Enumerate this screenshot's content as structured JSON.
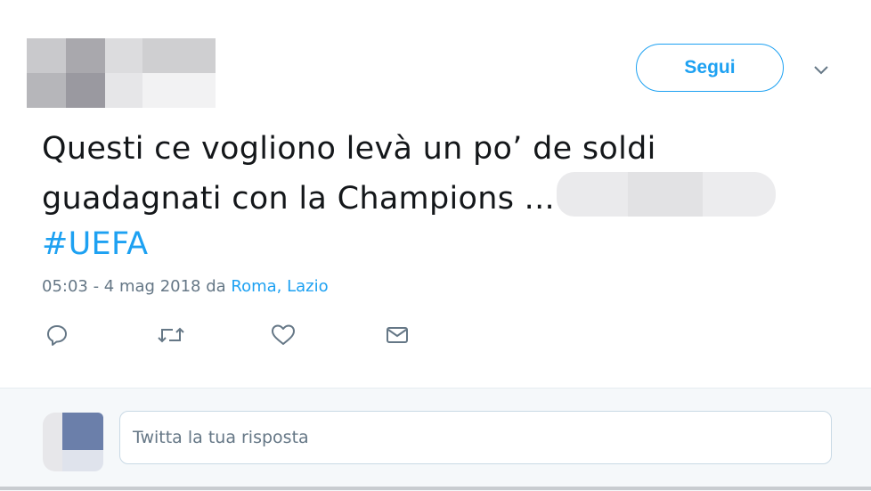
{
  "header": {
    "follow_label": "Segui"
  },
  "tweet": {
    "text_line1": "Questi ce vogliono levà un po’ de soldi",
    "text_line2": "guadagnati con la Champions ...",
    "hashtag": "#UEFA",
    "timestamp": "05:03 - 4 mag 2018 da ",
    "location": "Roma, Lazio"
  },
  "actions": {
    "reply_icon": "reply-icon",
    "retweet_icon": "retweet-icon",
    "like_icon": "heart-icon",
    "dm_icon": "envelope-icon"
  },
  "reply": {
    "placeholder": "Twitta la tua risposta"
  },
  "colors": {
    "accent": "#1da1f2",
    "muted": "#657786"
  }
}
